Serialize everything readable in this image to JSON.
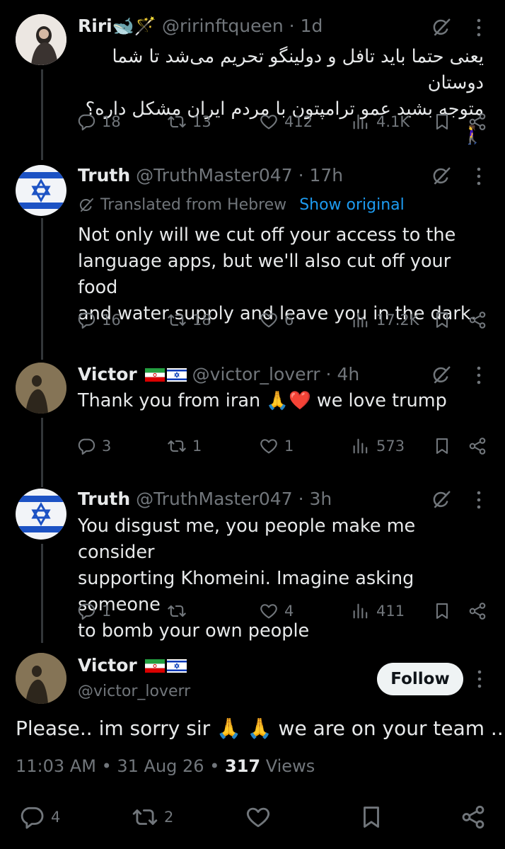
{
  "tweets": [
    {
      "name": "Riri",
      "name_emojis": "🐋🪄",
      "handle": "@ririnftqueen",
      "time": "1d",
      "text_lines": [
        "یعنی حتما باید تافل و دولینگو تحریم می‌شد تا شما دوستان",
        "متوجه بشید عمو ترامپتون با مردم ایران مشکل داره؟ 🚶‍♀️"
      ],
      "replies": "18",
      "reposts": "13",
      "likes": "412",
      "views": "4.1K"
    },
    {
      "name": "Truth",
      "handle": "@TruthMaster047",
      "time": "17h",
      "translated_label": "Translated from Hebrew",
      "show_original": "Show original",
      "text_lines": [
        "Not only will we cut off your access to the",
        "language apps, but we'll also cut off your food",
        "and water supply and leave you in the dark."
      ],
      "replies": "16",
      "reposts": "18",
      "likes": "6",
      "views": "17.2K"
    },
    {
      "name": "Victor",
      "handle": "@victor_loverr",
      "time": "4h",
      "text": "Thank you from iran 🙏❤️ we love trump",
      "replies": "3",
      "reposts": "1",
      "likes": "1",
      "views": "573"
    },
    {
      "name": "Truth",
      "handle": "@TruthMaster047",
      "time": "3h",
      "text_lines": [
        "You disgust me, you people make me consider",
        "supporting Khomeini. Imagine asking someone",
        "to bomb your own people"
      ],
      "replies": "1",
      "reposts": "",
      "likes": "4",
      "views": "411"
    }
  ],
  "main": {
    "name": "Victor",
    "handle": "@victor_loverr",
    "follow_label": "Follow",
    "text": "Please.. im sorry sir 🙏 🙏 we are on your team ..",
    "time": "11:03 AM",
    "date": "31 Aug 26",
    "views_count": "317",
    "views_label": "Views",
    "replies": "4",
    "reposts": "2"
  },
  "separator": "·",
  "colors": {
    "accent": "#1d9bf0",
    "muted": "#71767b",
    "text": "#e7e9ea",
    "background": "#000000"
  },
  "icons": [
    "reply-icon",
    "repost-icon",
    "like-icon",
    "views-icon",
    "bookmark-icon",
    "share-icon",
    "grok-icon",
    "more-icon"
  ]
}
